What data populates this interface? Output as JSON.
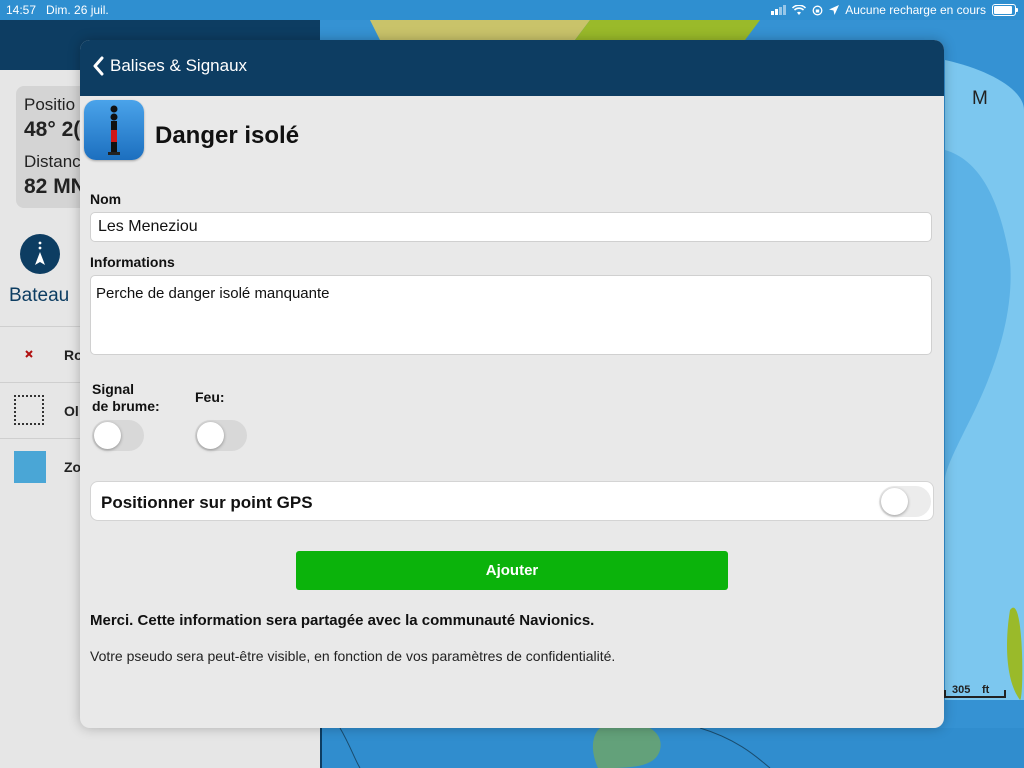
{
  "status_bar": {
    "time": "14:57",
    "date": "Dim. 26 juil.",
    "battery_text": "Aucune recharge en cours"
  },
  "background": {
    "position_label": "Positio",
    "position_value": "48° 2(",
    "distance_label": "Distanc",
    "distance_value": "82 MN",
    "boat_label": "Bateau",
    "row_items": [
      "Ro",
      "Ol",
      "Zo"
    ],
    "map_letter": "M",
    "scale_value": "305",
    "scale_unit": "ft"
  },
  "modal": {
    "back_label": "Balises & Signaux",
    "title": "Danger isolé",
    "name_label": "Nom",
    "name_value": "Les Meneziou",
    "info_label": "Informations",
    "info_value": "Perche de danger isolé manquante",
    "fog_signal_label_line1": "Signal",
    "fog_signal_label_line2": "de brume:",
    "light_label": "Feu:",
    "gps_label": "Positionner sur point GPS",
    "add_button": "Ajouter",
    "thanks_text": "Merci. Cette information sera partagée avec la communauté Navionics.",
    "privacy_text": "Votre pseudo sera peut-être visible, en fonction de vos paramètres de confidentialité."
  },
  "colors": {
    "header": "#0d3d62",
    "add_button": "#0bb30b",
    "map_water": "#2f8fd0",
    "map_land": "#9aba2a"
  },
  "toggles": {
    "fog_signal": false,
    "light": false,
    "gps": false
  }
}
